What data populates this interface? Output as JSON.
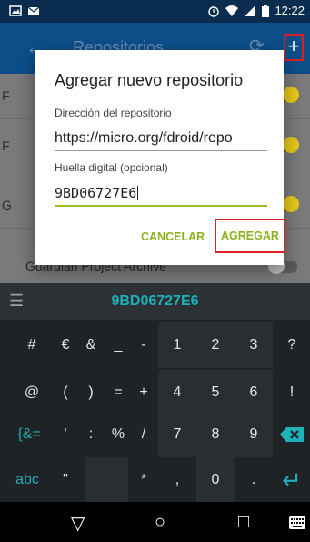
{
  "status_bar": {
    "time": "12:22"
  },
  "app_bar": {
    "title": "Repositorios",
    "back_icon": "arrow-back-icon",
    "refresh_icon": "refresh-icon",
    "add_icon": "plus-icon",
    "add_symbol": "+"
  },
  "list": {
    "items": [
      {
        "label": "F"
      },
      {
        "label": "F"
      },
      {
        "label": "G"
      },
      {
        "label": "Guardian Project Archive"
      }
    ]
  },
  "dialog": {
    "title": "Agregar nuevo repositorio",
    "address_label": "Dirección del repositorio",
    "address_value": "https://micro.org/fdroid/repo",
    "fingerprint_label": "Huella digital (opcional)",
    "fingerprint_value": "9BD06727E6",
    "cancel_label": "CANCELAR",
    "add_label": "AGREGAR"
  },
  "keyboard": {
    "suggestion": "9BD06727E6",
    "rows": [
      [
        "#",
        "€",
        "&",
        "_",
        "-",
        "1",
        "2",
        "3",
        "?"
      ],
      [
        "@",
        "(",
        ")",
        "=",
        "+",
        "4",
        "5",
        "6",
        "!"
      ],
      [
        "{&=",
        "'",
        ":",
        "%",
        "/",
        "7",
        "8",
        "9",
        "⌫"
      ],
      [
        "abc",
        "\"",
        "",
        "*",
        ",",
        "0",
        ".",
        "↵"
      ]
    ]
  },
  "nav": {
    "back": "▽",
    "home": "○",
    "recents": "□"
  },
  "colors": {
    "accent": "#8cb21f",
    "highlight": "#e02020",
    "appbar": "#0e4f8a",
    "keyboard_teal": "#1fb0b8"
  }
}
